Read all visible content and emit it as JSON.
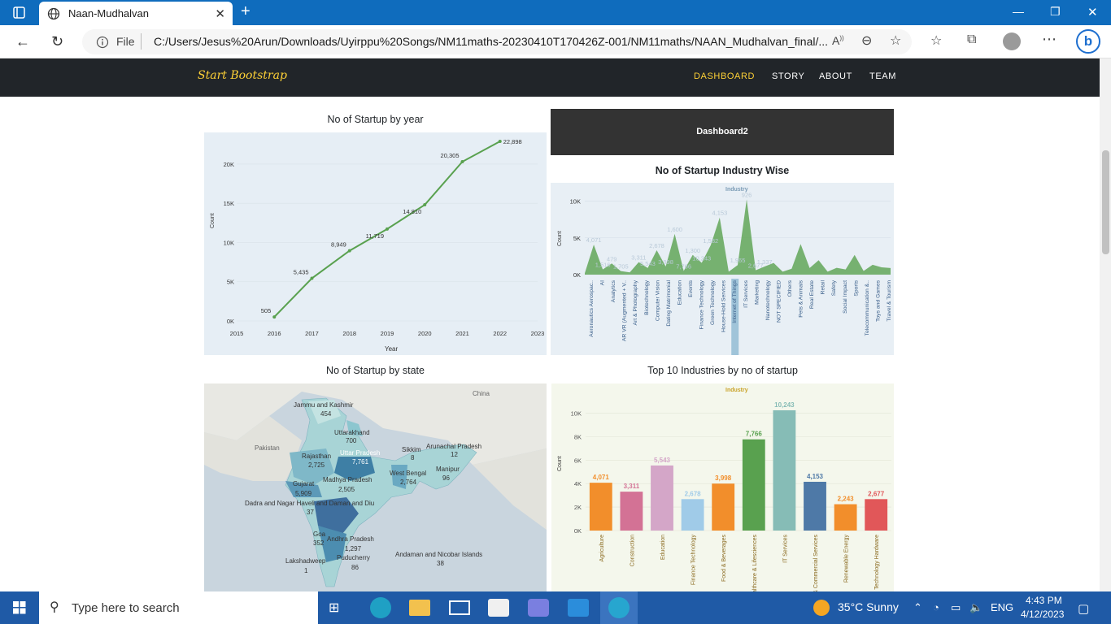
{
  "browser": {
    "tab_title": "Naan-Mudhalvan",
    "file_label": "File",
    "url": "C:/Users/Jesus%20Arun/Downloads/Uyirppu%20Songs/NM11maths-20230410T170426Z-001/NM11maths/NAAN_Mudhalvan_final/..."
  },
  "site": {
    "brand": "Start Bootstrap",
    "nav": [
      "DASHBOARD",
      "STORY",
      "ABOUT",
      "TEAM"
    ],
    "active_nav": "DASHBOARD",
    "accent_color": "#fed136"
  },
  "panel1": {
    "title": "No of Startup by year",
    "ylabel": "Count",
    "xlabel": "Year",
    "yticks": [
      "0K",
      "5K",
      "10K",
      "15K",
      "20K"
    ],
    "xticks": [
      "2015",
      "2016",
      "2017",
      "2018",
      "2019",
      "2020",
      "2021",
      "2022",
      "2023"
    ]
  },
  "panel2": {
    "header": "Dashboard2",
    "title": "No of Startup Industry Wise",
    "legend_title": "Industry",
    "ylabel": "Count",
    "yticks": [
      "0K",
      "5K",
      "10K"
    ],
    "x_labels": [
      "Aeronautics Aerospac..",
      "AI",
      "Analytics",
      "AR VR (Augmented + V..",
      "Art & Photography",
      "Biotechnology",
      "Computer Vision",
      "Dating Matrimonial",
      "Education",
      "Events",
      "Finance Technology",
      "Green Technology",
      "House-Hold Services",
      "Internet of Things",
      "IT Services",
      "Marketing",
      "Nanotechnology",
      "NOT SPECIFIED",
      "Others",
      "Pets & Animals",
      "Real Estate",
      "Retail",
      "Safety",
      "Social Impact",
      "Sports",
      "Telecommunication &..",
      "Toys and Games",
      "Travel & Tourism"
    ],
    "peak_labels": [
      "4,071",
      "1,516",
      "479",
      "1,705",
      "3,311",
      "5,543",
      "2,678",
      "3,998",
      "1,600",
      "7,766",
      "1,300",
      "10,243",
      "1,582",
      "4,153",
      "1,965",
      "926",
      "2,677",
      "1,337"
    ]
  },
  "panel3": {
    "title": "No of Startup by state",
    "country_labels": [
      "China",
      "Pakistan"
    ],
    "state_labels": [
      {
        "name": "Jammu and Kashmir",
        "value": "454"
      },
      {
        "name": "Uttarakhand",
        "value": "700"
      },
      {
        "name": "Uttar Pradesh",
        "value": "7,761"
      },
      {
        "name": "Rajasthan",
        "value": "2,725"
      },
      {
        "name": "Sikkim",
        "value": "8"
      },
      {
        "name": "Arunachal Pradesh",
        "value": "12"
      },
      {
        "name": "West Bengal",
        "value": "2,764"
      },
      {
        "name": "Manipur",
        "value": "96"
      },
      {
        "name": "Madhya Pradesh",
        "value": "2,505"
      },
      {
        "name": "Gujarat",
        "value": "5,909"
      },
      {
        "name": "Dadra and Nagar Haveli and Daman and Diu",
        "value": "37"
      },
      {
        "name": "Goa",
        "value": "352"
      },
      {
        "name": "Andhra Pradesh",
        "value": "1,297"
      },
      {
        "name": "Puducherry",
        "value": "86"
      },
      {
        "name": "Andaman and Nicobar Islands",
        "value": "38"
      },
      {
        "name": "Lakshadweep",
        "value": "1"
      }
    ]
  },
  "panel4": {
    "title": "Top 10 Industries by no of startup",
    "legend_title": "Industry",
    "ylabel": "Count",
    "yticks": [
      "0K",
      "2K",
      "4K",
      "6K",
      "8K",
      "10K"
    ]
  },
  "chart_data": [
    {
      "type": "line",
      "title": "No of Startup by year",
      "xlabel": "Year",
      "ylabel": "Count",
      "x": [
        2016,
        2017,
        2018,
        2019,
        2020,
        2021,
        2022
      ],
      "values": [
        505,
        5435,
        8949,
        11719,
        14810,
        20305,
        22898
      ],
      "labels": [
        "505",
        "5,435",
        "8,949",
        "11,719",
        "14,810",
        "20,305",
        "22,898"
      ],
      "xlim": [
        2015,
        2023
      ],
      "ylim": [
        0,
        23000
      ],
      "color": "#59a14f"
    },
    {
      "type": "area",
      "title": "No of Startup Industry Wise",
      "ylabel": "Count",
      "ylim": [
        0,
        10500
      ],
      "color": "#59a14f",
      "values": [
        200,
        4071,
        700,
        1516,
        479,
        300,
        1705,
        900,
        3311,
        1100,
        5543,
        500,
        2678,
        1600,
        3998,
        7766,
        400,
        1300,
        10243,
        600,
        1100,
        1582,
        400,
        800,
        4153,
        900,
        1965,
        400,
        926,
        700,
        2677,
        500,
        1337,
        1000,
        900
      ]
    },
    {
      "type": "bar",
      "title": "Top 10 Industries by no of startup",
      "ylabel": "Count",
      "ylim": [
        0,
        11000
      ],
      "categories": [
        "Agriculture",
        "Construction",
        "Education",
        "Finance Technology",
        "Food & Beverages",
        "Healthcare & Lifesciences",
        "IT Services",
        "Professional & Commercial Services",
        "Renewable Energy",
        "Technology Hardware"
      ],
      "values": [
        4071,
        3311,
        5543,
        2678,
        3998,
        7766,
        10243,
        4153,
        2243,
        2677
      ],
      "labels": [
        "4,071",
        "3,311",
        "5,543",
        "2,678",
        "3,998",
        "7,766",
        "10,243",
        "4,153",
        "2,243",
        "2,677"
      ],
      "colors": [
        "#f28e2b",
        "#d37295",
        "#d4a6c8",
        "#a0cbe8",
        "#f28e2b",
        "#59a14f",
        "#86bcb6",
        "#4e79a7",
        "#f28e2b",
        "#e15759"
      ]
    }
  ],
  "taskbar": {
    "search_placeholder": "Type here to search",
    "weather": "35°C  Sunny",
    "lang": "ENG",
    "time": "4:43 PM",
    "date": "4/12/2023"
  }
}
